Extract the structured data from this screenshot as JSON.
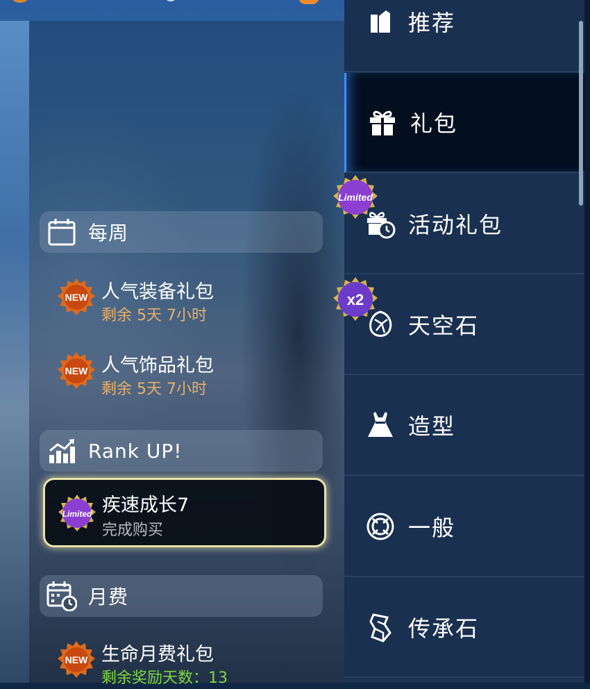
{
  "colors": {
    "accent_blue": "#3d8dff",
    "new_badge": "#e06a1a",
    "limited_badge": "#8a3fd0",
    "countdown_orange": "#e8b06a",
    "remaining_green": "#7cd83e",
    "selected_border": "#e9e2a8"
  },
  "left": {
    "sections": [
      {
        "title": "每周",
        "icon": "calendar-icon"
      },
      {
        "title": "Rank UP!",
        "icon": "growth-chart-icon"
      },
      {
        "title": "月费",
        "icon": "calendar-clock-icon"
      }
    ],
    "weekly_items": [
      {
        "title": "人气装备礼包",
        "sub": "剩余 5天 7小时",
        "badge": "NEW"
      },
      {
        "title": "人气饰品礼包",
        "sub": "剩余 5天 7小时",
        "badge": "NEW"
      }
    ],
    "rank_items": [
      {
        "title": "疾速成长7",
        "sub": "完成购买",
        "badge": "Limited",
        "selected": true
      }
    ],
    "monthly_items": [
      {
        "title": "生命月费礼包",
        "sub": "剩余奖励天数：13",
        "badge": "NEW"
      }
    ]
  },
  "nav": {
    "items": [
      {
        "label": "推荐",
        "icon": "recommend-icon"
      },
      {
        "label": "礼包",
        "icon": "gift-icon",
        "active": true
      },
      {
        "label": "活动礼包",
        "icon": "timed-gift-icon",
        "badge": "Limited"
      },
      {
        "label": "天空石",
        "icon": "sky-stone-icon",
        "badge": "x2"
      },
      {
        "label": "造型",
        "icon": "dress-icon"
      },
      {
        "label": "一般",
        "icon": "general-icon"
      },
      {
        "label": "传承石",
        "icon": "inheritance-stone-icon"
      }
    ]
  }
}
